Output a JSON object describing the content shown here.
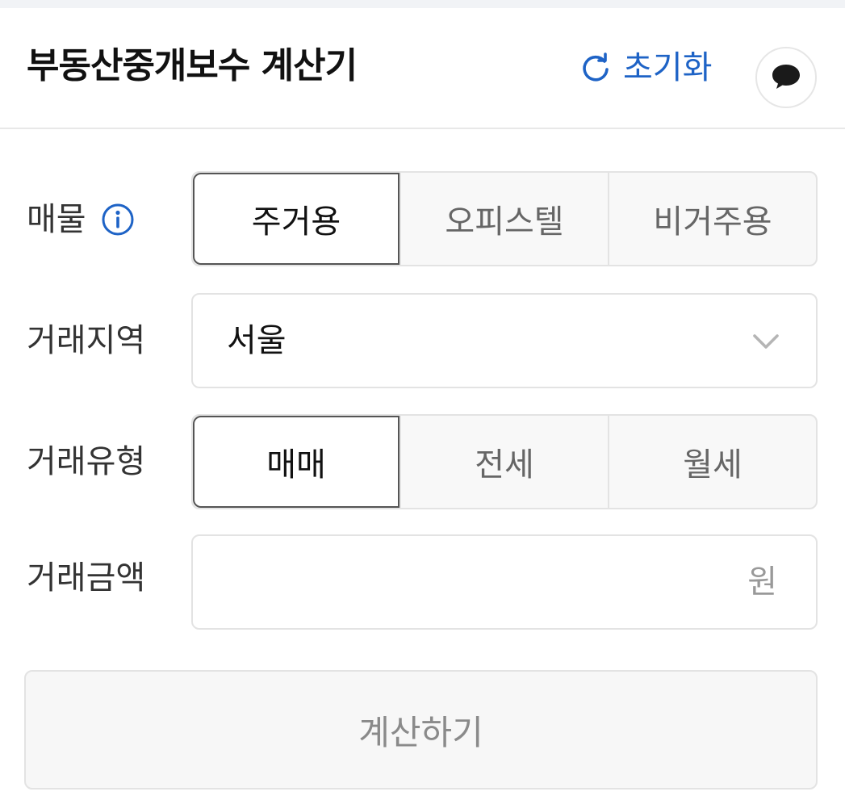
{
  "header": {
    "title": "부동산중개보수 계산기",
    "reset_label": "초기화",
    "reset_icon": "refresh-icon",
    "chat_icon": "speech-bubble-icon",
    "accent_color": "#1e63c6"
  },
  "property": {
    "label": "매물",
    "info_icon": "info-icon",
    "options": [
      "주거용",
      "오피스텔",
      "비거주용"
    ],
    "selected": "주거용"
  },
  "region": {
    "label": "거래지역",
    "value": "서울",
    "chevron_icon": "chevron-down-icon"
  },
  "deal_type": {
    "label": "거래유형",
    "options": [
      "매매",
      "전세",
      "월세"
    ],
    "selected": "매매"
  },
  "amount": {
    "label": "거래금액",
    "value": "",
    "unit": "원"
  },
  "calculate_label": "계산하기"
}
